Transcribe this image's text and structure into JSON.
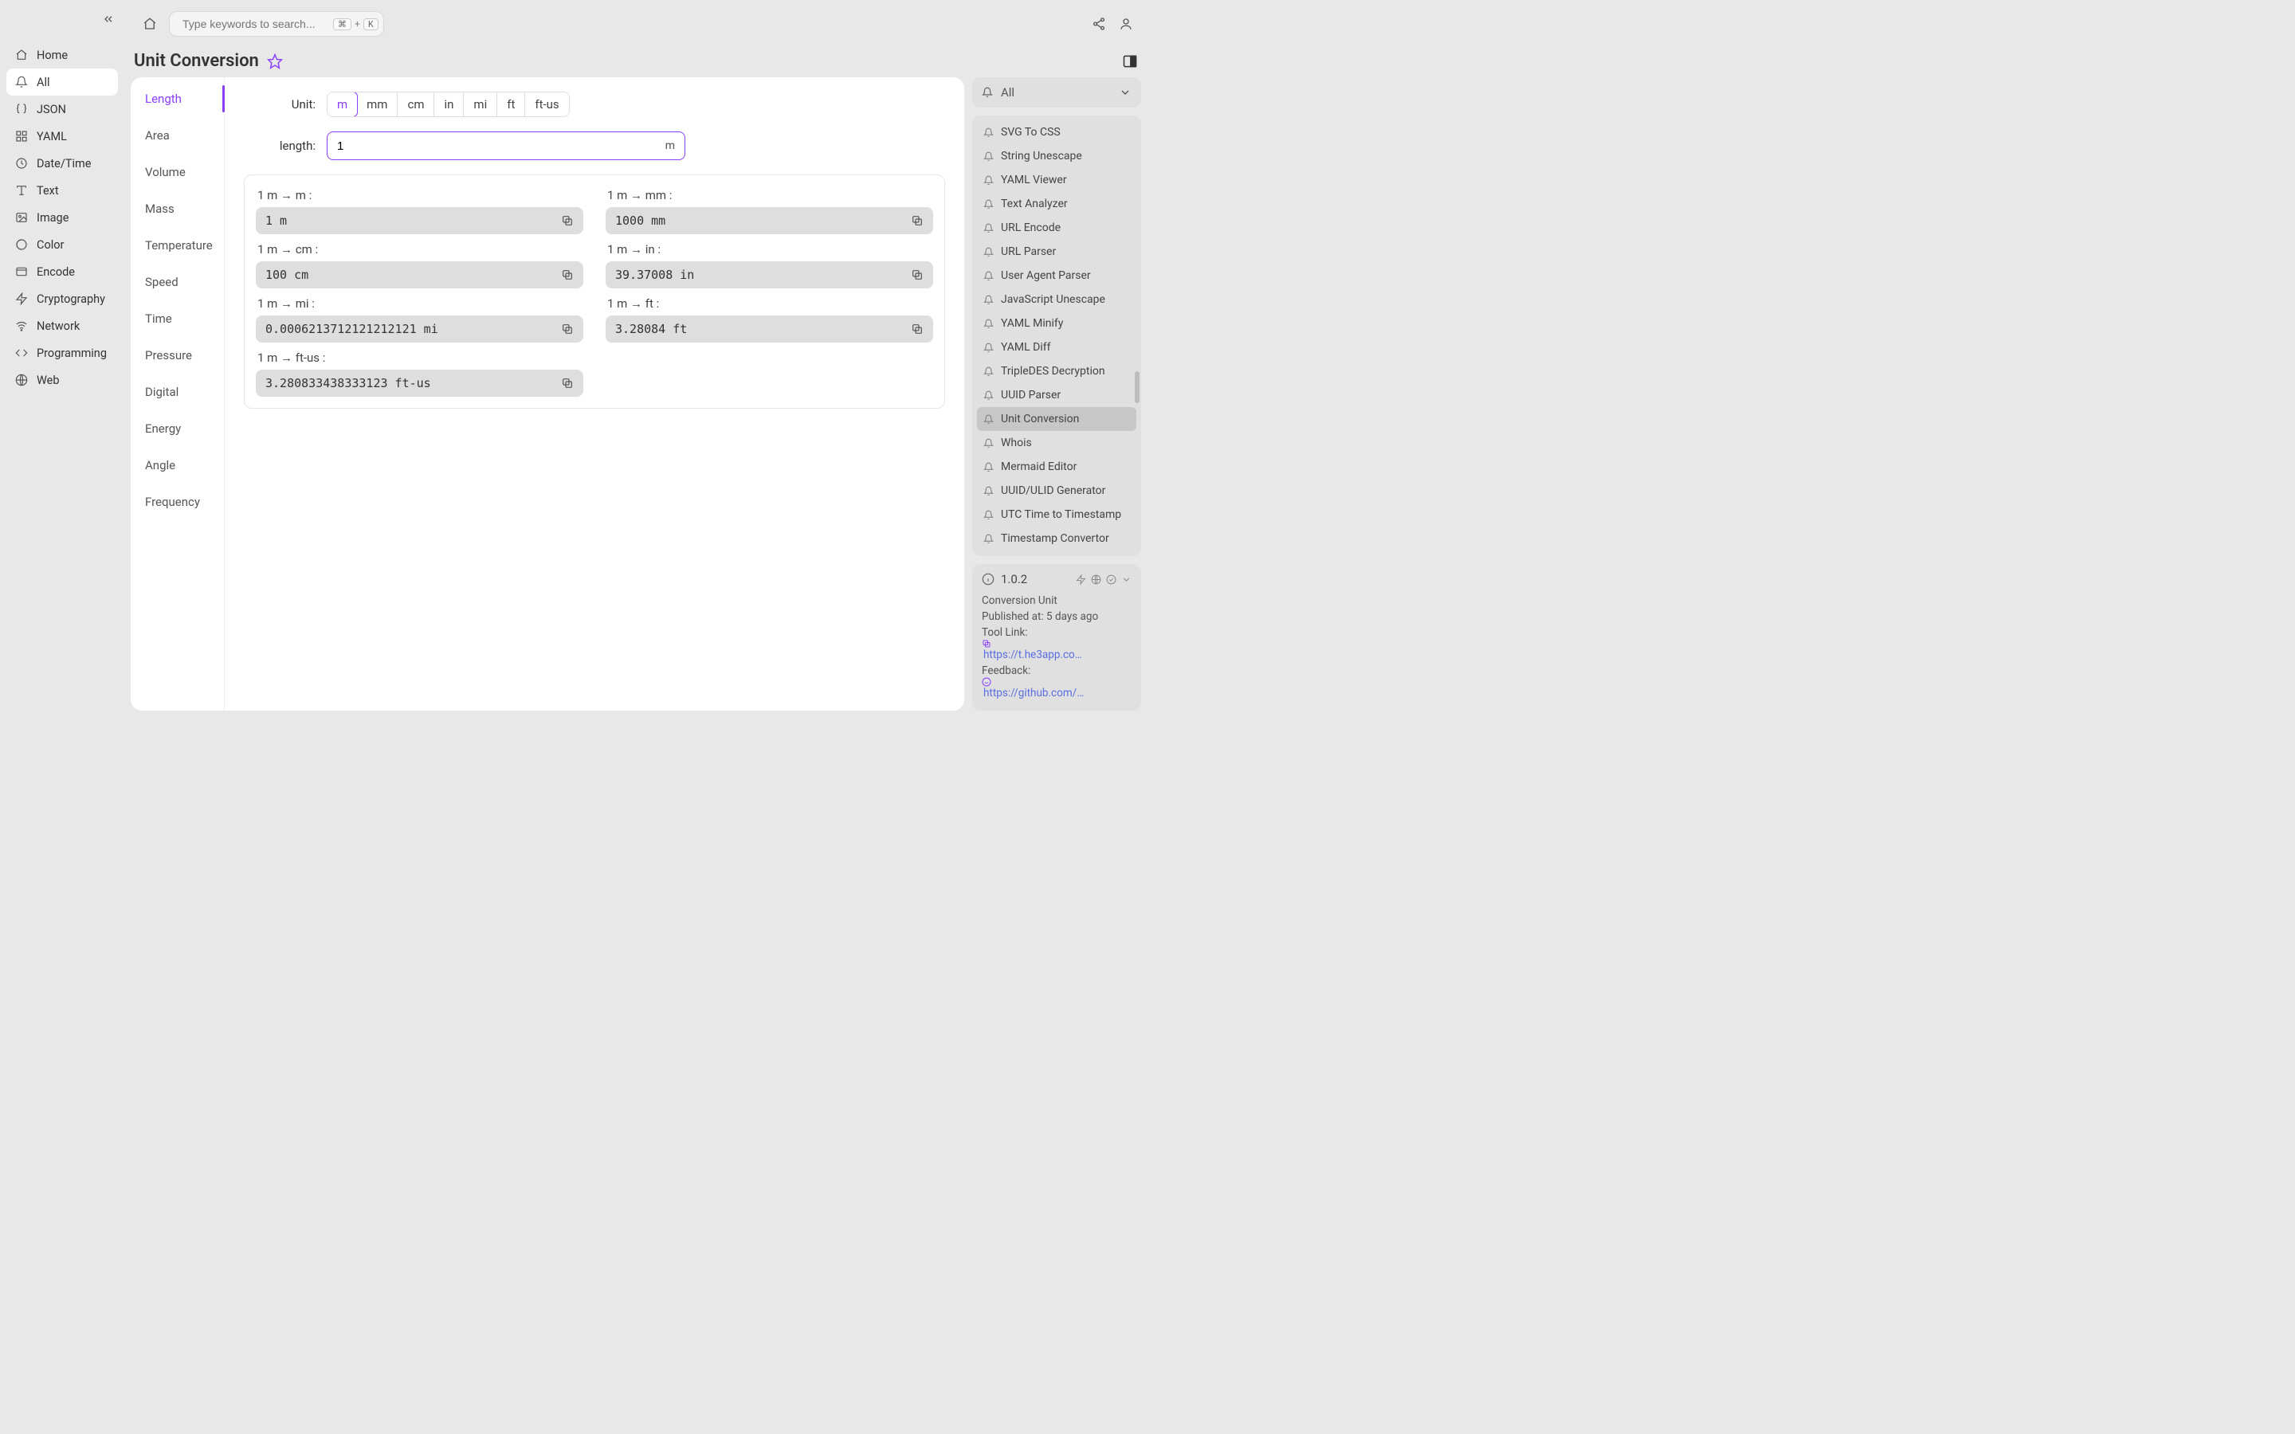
{
  "search": {
    "placeholder": "Type keywords to search...",
    "kbd1": "⌘",
    "plus": "+",
    "kbd2": "K"
  },
  "leftnav": {
    "items": [
      {
        "label": "Home",
        "icon": "home"
      },
      {
        "label": "All",
        "icon": "bell",
        "active": true
      },
      {
        "label": "JSON",
        "icon": "braces"
      },
      {
        "label": "YAML",
        "icon": "grid"
      },
      {
        "label": "Date/Time",
        "icon": "clock"
      },
      {
        "label": "Text",
        "icon": "text"
      },
      {
        "label": "Image",
        "icon": "image"
      },
      {
        "label": "Color",
        "icon": "color"
      },
      {
        "label": "Encode",
        "icon": "encode"
      },
      {
        "label": "Cryptography",
        "icon": "bolt"
      },
      {
        "label": "Network",
        "icon": "wifi"
      },
      {
        "label": "Programming",
        "icon": "code"
      },
      {
        "label": "Web",
        "icon": "globe"
      }
    ]
  },
  "page": {
    "title": "Unit Conversion"
  },
  "categories": [
    "Length",
    "Area",
    "Volume",
    "Mass",
    "Temperature",
    "Speed",
    "Time",
    "Pressure",
    "Digital",
    "Energy",
    "Angle",
    "Frequency"
  ],
  "active_category": "Length",
  "unit_row": {
    "label": "Unit:",
    "options": [
      "m",
      "mm",
      "cm",
      "in",
      "mi",
      "ft",
      "ft-us"
    ],
    "active": "m"
  },
  "length_row": {
    "label": "length:",
    "value": "1",
    "suffix": "m"
  },
  "results": [
    {
      "label": "1 m → m :",
      "value": "1 m"
    },
    {
      "label": "1 m → mm :",
      "value": "1000 mm"
    },
    {
      "label": "1 m → cm :",
      "value": "100 cm"
    },
    {
      "label": "1 m → in :",
      "value": "39.37008 in"
    },
    {
      "label": "1 m → mi :",
      "value": "0.0006213712121212121 mi"
    },
    {
      "label": "1 m → ft :",
      "value": "3.28084 ft"
    },
    {
      "label": "1 m → ft-us :",
      "value": "3.280833438333123 ft-us"
    }
  ],
  "right": {
    "header": "All",
    "items": [
      "SVG To CSS",
      "String Unescape",
      "YAML Viewer",
      "Text Analyzer",
      "URL Encode",
      "URL Parser",
      "User Agent Parser",
      "JavaScript Unescape",
      "YAML Minify",
      "YAML Diff",
      "TripleDES Decryption",
      "UUID Parser",
      "Unit Conversion",
      "Whois",
      "Mermaid Editor",
      "UUID/ULID Generator",
      "UTC Time to Timestamp",
      "Timestamp Convertor"
    ],
    "active": "Unit Conversion"
  },
  "info": {
    "version": "1.0.2",
    "title": "Conversion Unit",
    "published_label": "Published at:",
    "published_value": "5 days ago",
    "toollink_label": "Tool Link:",
    "toollink_value": "https://t.he3app.co…",
    "feedback_label": "Feedback:",
    "feedback_value": "https://github.com/…"
  }
}
